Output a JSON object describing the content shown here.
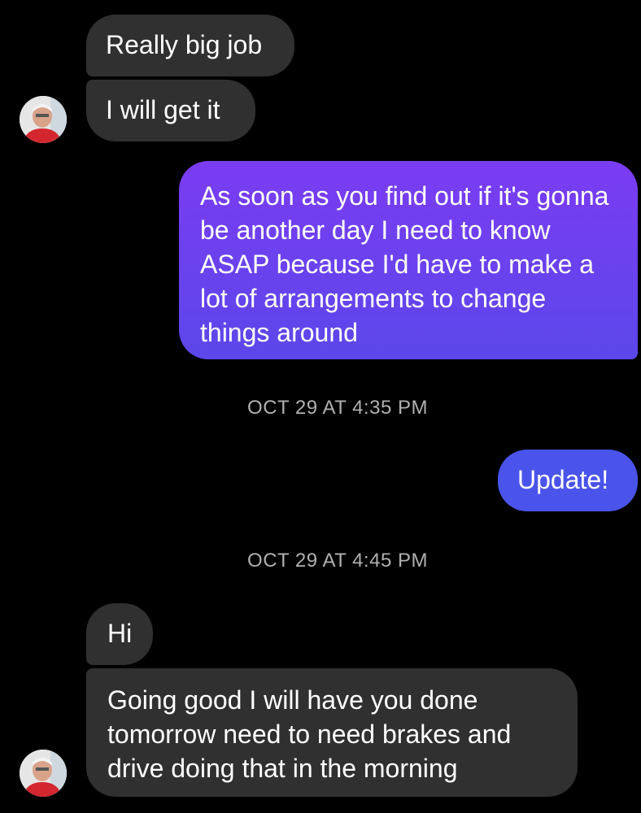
{
  "conversation": {
    "messages": [
      {
        "sender": "contact",
        "text": "Really big job"
      },
      {
        "sender": "contact",
        "text": "I will get it"
      },
      {
        "sender": "me",
        "text": "As soon as you find out if it's gonna be another day I need to know ASAP because I'd have to make a lot of arrangements to change things around"
      },
      {
        "sender": "me",
        "text": "Update!"
      },
      {
        "sender": "contact",
        "text": "Hi"
      },
      {
        "sender": "contact",
        "text": "Going good I will have you done tomorrow need to need brakes and drive doing that in the morning"
      }
    ],
    "timestamps": [
      "OCT 29 AT 4:35 PM",
      "OCT 29 AT 4:45 PM"
    ]
  },
  "colors": {
    "background": "#000000",
    "incoming_bubble": "#303030",
    "outgoing_gradient_top": "#7b3cf2",
    "outgoing_gradient_bottom": "#5b47ea",
    "outgoing_solid": "#4a54ea",
    "timestamp_text": "#b0b0b0"
  },
  "avatars": [
    {
      "icon": "contact-avatar-photo"
    },
    {
      "icon": "contact-avatar-photo"
    }
  ]
}
